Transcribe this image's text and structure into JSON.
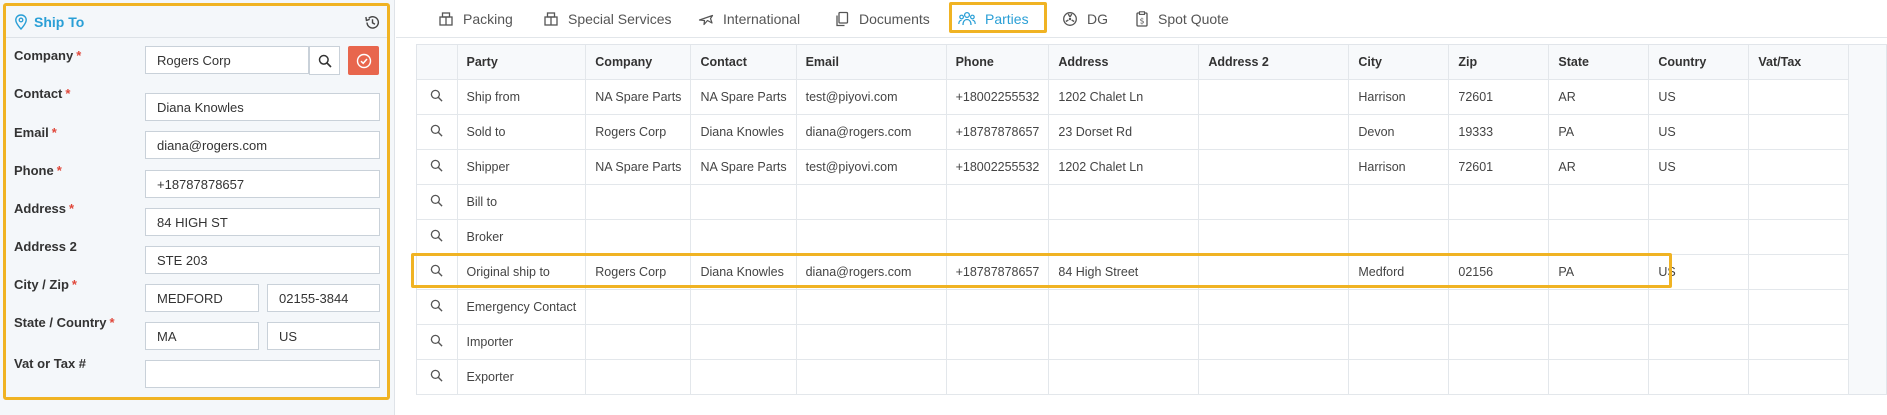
{
  "panel": {
    "title": "Ship To",
    "fields": {
      "company": {
        "label": "Company",
        "value": "Rogers Corp"
      },
      "contact": {
        "label": "Contact",
        "value": "Diana Knowles"
      },
      "email": {
        "label": "Email",
        "value": "diana@rogers.com"
      },
      "phone": {
        "label": "Phone",
        "value": "+18787878657"
      },
      "address": {
        "label": "Address",
        "value": "84 HIGH ST"
      },
      "address2": {
        "label": "Address 2",
        "value": "STE 203"
      },
      "city_zip": {
        "label": "City / Zip",
        "city": "MEDFORD",
        "zip": "02155-3844"
      },
      "state_country": {
        "label": "State / Country",
        "state": "MA",
        "country": "US"
      },
      "vat": {
        "label": "Vat or Tax #",
        "value": ""
      }
    },
    "required_mark": "*"
  },
  "tabs": [
    {
      "label": "Packing",
      "icon": "packing-icon"
    },
    {
      "label": "Special Services",
      "icon": "special-services-icon"
    },
    {
      "label": "International",
      "icon": "plane-icon"
    },
    {
      "label": "Documents",
      "icon": "documents-icon"
    },
    {
      "label": "Parties",
      "icon": "parties-icon",
      "active": true
    },
    {
      "label": "DG",
      "icon": "dg-icon"
    },
    {
      "label": "Spot Quote",
      "icon": "spot-quote-icon"
    }
  ],
  "table": {
    "columns": [
      "Party",
      "Company",
      "Contact",
      "Email",
      "Phone",
      "Address",
      "Address 2",
      "City",
      "Zip",
      "State",
      "Country",
      "Vat/Tax"
    ],
    "rows": [
      [
        "Ship from",
        "NA Spare Parts",
        "NA Spare Parts",
        "test@piyovi.com",
        "+18002255532",
        "1202 Chalet Ln",
        "",
        "Harrison",
        "72601",
        "AR",
        "US",
        ""
      ],
      [
        "Sold to",
        "Rogers Corp",
        "Diana Knowles",
        "diana@rogers.com",
        "+18787878657",
        "23 Dorset Rd",
        "",
        "Devon",
        "19333",
        "PA",
        "US",
        ""
      ],
      [
        "Shipper",
        "NA Spare Parts",
        "NA Spare Parts",
        "test@piyovi.com",
        "+18002255532",
        "1202 Chalet Ln",
        "",
        "Harrison",
        "72601",
        "AR",
        "US",
        ""
      ],
      [
        "Bill to",
        "",
        "",
        "",
        "",
        "",
        "",
        "",
        "",
        "",
        "",
        ""
      ],
      [
        "Broker",
        "",
        "",
        "",
        "",
        "",
        "",
        "",
        "",
        "",
        "",
        ""
      ],
      [
        "Original ship to",
        "Rogers Corp",
        "Diana Knowles",
        "diana@rogers.com",
        "+18787878657",
        "84 High Street",
        "",
        "Medford",
        "02156",
        "PA",
        "US",
        ""
      ],
      [
        "Emergency Contact",
        "",
        "",
        "",
        "",
        "",
        "",
        "",
        "",
        "",
        "",
        ""
      ],
      [
        "Importer",
        "",
        "",
        "",
        "",
        "",
        "",
        "",
        "",
        "",
        "",
        ""
      ],
      [
        "Exporter",
        "",
        "",
        "",
        "",
        "",
        "",
        "",
        "",
        "",
        "",
        ""
      ]
    ]
  },
  "colors": {
    "accent": "#2a9fd6",
    "highlight": "#f0b323",
    "required": "#e0473a",
    "confirm_button": "#e8664d"
  }
}
